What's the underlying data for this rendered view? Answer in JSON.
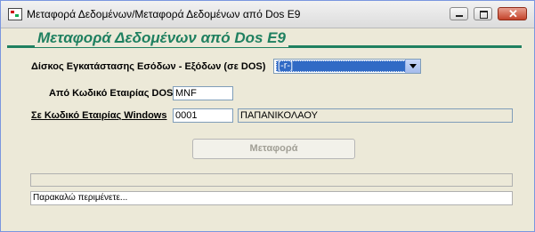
{
  "window": {
    "title": "Μεταφορά Δεδομένων/Μεταφορά Δεδομένων από Dos E9",
    "controls": [
      "minimize-icon",
      "maximize-icon",
      "close-icon"
    ]
  },
  "header": {
    "title": "Μεταφορά Δεδομένων από Dos E9",
    "accent_color": "#1f8060"
  },
  "form": {
    "drive_label": "Δίσκος Εγκατάστασης Εσόδων - Εξόδων (σε DOS)",
    "drive_value": "[-r-]",
    "from_company_label": "Από Κωδικό Εταιρίας DOS",
    "from_company_value": "MNF",
    "to_company_label": "Σε Κωδικό Εταιρίας Windows",
    "to_company_code": "0001",
    "to_company_name": "ΠΑΠΑΝΙΚΟΛΑΟΥ"
  },
  "actions": {
    "transfer_label": "Μεταφορά"
  },
  "status": {
    "progress_percent": 0,
    "message": "Παρακαλώ περιμένετε..."
  }
}
